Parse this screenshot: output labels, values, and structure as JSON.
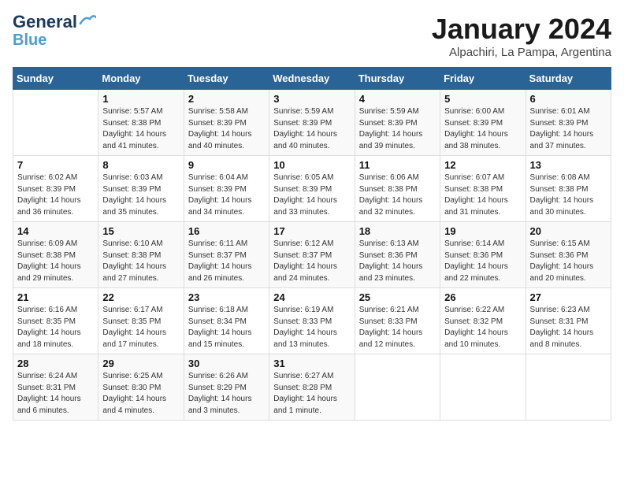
{
  "logo": {
    "line1": "General",
    "line2": "Blue"
  },
  "title": "January 2024",
  "subtitle": "Alpachiri, La Pampa, Argentina",
  "days_header": [
    "Sunday",
    "Monday",
    "Tuesday",
    "Wednesday",
    "Thursday",
    "Friday",
    "Saturday"
  ],
  "weeks": [
    [
      {
        "day": "",
        "info": ""
      },
      {
        "day": "1",
        "info": "Sunrise: 5:57 AM\nSunset: 8:38 PM\nDaylight: 14 hours\nand 41 minutes."
      },
      {
        "day": "2",
        "info": "Sunrise: 5:58 AM\nSunset: 8:39 PM\nDaylight: 14 hours\nand 40 minutes."
      },
      {
        "day": "3",
        "info": "Sunrise: 5:59 AM\nSunset: 8:39 PM\nDaylight: 14 hours\nand 40 minutes."
      },
      {
        "day": "4",
        "info": "Sunrise: 5:59 AM\nSunset: 8:39 PM\nDaylight: 14 hours\nand 39 minutes."
      },
      {
        "day": "5",
        "info": "Sunrise: 6:00 AM\nSunset: 8:39 PM\nDaylight: 14 hours\nand 38 minutes."
      },
      {
        "day": "6",
        "info": "Sunrise: 6:01 AM\nSunset: 8:39 PM\nDaylight: 14 hours\nand 37 minutes."
      }
    ],
    [
      {
        "day": "7",
        "info": "Sunrise: 6:02 AM\nSunset: 8:39 PM\nDaylight: 14 hours\nand 36 minutes."
      },
      {
        "day": "8",
        "info": "Sunrise: 6:03 AM\nSunset: 8:39 PM\nDaylight: 14 hours\nand 35 minutes."
      },
      {
        "day": "9",
        "info": "Sunrise: 6:04 AM\nSunset: 8:39 PM\nDaylight: 14 hours\nand 34 minutes."
      },
      {
        "day": "10",
        "info": "Sunrise: 6:05 AM\nSunset: 8:39 PM\nDaylight: 14 hours\nand 33 minutes."
      },
      {
        "day": "11",
        "info": "Sunrise: 6:06 AM\nSunset: 8:38 PM\nDaylight: 14 hours\nand 32 minutes."
      },
      {
        "day": "12",
        "info": "Sunrise: 6:07 AM\nSunset: 8:38 PM\nDaylight: 14 hours\nand 31 minutes."
      },
      {
        "day": "13",
        "info": "Sunrise: 6:08 AM\nSunset: 8:38 PM\nDaylight: 14 hours\nand 30 minutes."
      }
    ],
    [
      {
        "day": "14",
        "info": "Sunrise: 6:09 AM\nSunset: 8:38 PM\nDaylight: 14 hours\nand 29 minutes."
      },
      {
        "day": "15",
        "info": "Sunrise: 6:10 AM\nSunset: 8:38 PM\nDaylight: 14 hours\nand 27 minutes."
      },
      {
        "day": "16",
        "info": "Sunrise: 6:11 AM\nSunset: 8:37 PM\nDaylight: 14 hours\nand 26 minutes."
      },
      {
        "day": "17",
        "info": "Sunrise: 6:12 AM\nSunset: 8:37 PM\nDaylight: 14 hours\nand 24 minutes."
      },
      {
        "day": "18",
        "info": "Sunrise: 6:13 AM\nSunset: 8:36 PM\nDaylight: 14 hours\nand 23 minutes."
      },
      {
        "day": "19",
        "info": "Sunrise: 6:14 AM\nSunset: 8:36 PM\nDaylight: 14 hours\nand 22 minutes."
      },
      {
        "day": "20",
        "info": "Sunrise: 6:15 AM\nSunset: 8:36 PM\nDaylight: 14 hours\nand 20 minutes."
      }
    ],
    [
      {
        "day": "21",
        "info": "Sunrise: 6:16 AM\nSunset: 8:35 PM\nDaylight: 14 hours\nand 18 minutes."
      },
      {
        "day": "22",
        "info": "Sunrise: 6:17 AM\nSunset: 8:35 PM\nDaylight: 14 hours\nand 17 minutes."
      },
      {
        "day": "23",
        "info": "Sunrise: 6:18 AM\nSunset: 8:34 PM\nDaylight: 14 hours\nand 15 minutes."
      },
      {
        "day": "24",
        "info": "Sunrise: 6:19 AM\nSunset: 8:33 PM\nDaylight: 14 hours\nand 13 minutes."
      },
      {
        "day": "25",
        "info": "Sunrise: 6:21 AM\nSunset: 8:33 PM\nDaylight: 14 hours\nand 12 minutes."
      },
      {
        "day": "26",
        "info": "Sunrise: 6:22 AM\nSunset: 8:32 PM\nDaylight: 14 hours\nand 10 minutes."
      },
      {
        "day": "27",
        "info": "Sunrise: 6:23 AM\nSunset: 8:31 PM\nDaylight: 14 hours\nand 8 minutes."
      }
    ],
    [
      {
        "day": "28",
        "info": "Sunrise: 6:24 AM\nSunset: 8:31 PM\nDaylight: 14 hours\nand 6 minutes."
      },
      {
        "day": "29",
        "info": "Sunrise: 6:25 AM\nSunset: 8:30 PM\nDaylight: 14 hours\nand 4 minutes."
      },
      {
        "day": "30",
        "info": "Sunrise: 6:26 AM\nSunset: 8:29 PM\nDaylight: 14 hours\nand 3 minutes."
      },
      {
        "day": "31",
        "info": "Sunrise: 6:27 AM\nSunset: 8:28 PM\nDaylight: 14 hours\nand 1 minute."
      },
      {
        "day": "",
        "info": ""
      },
      {
        "day": "",
        "info": ""
      },
      {
        "day": "",
        "info": ""
      }
    ]
  ]
}
